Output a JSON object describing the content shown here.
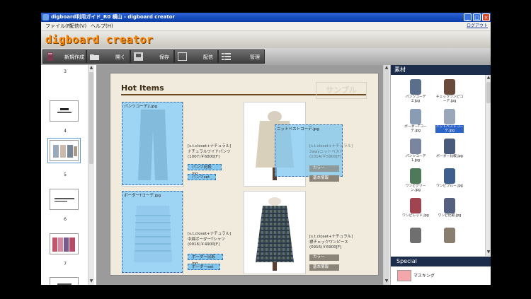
{
  "window": {
    "title": "digboard利用ガイド_R0 横山 - digboard creator",
    "controls": [
      "_",
      "□",
      "×"
    ]
  },
  "menu": {
    "items": [
      "ファイル(F)",
      "配信(V)",
      "ヘルプ(H)"
    ],
    "logout": "ログアウト"
  },
  "brand": {
    "logo": "digboard creator"
  },
  "toolbar": {
    "new": "新規作成",
    "open": "開く",
    "save": "保存",
    "publish": "配信",
    "manage": "管理"
  },
  "pages": {
    "numbers": [
      "3",
      "4",
      "5",
      "6",
      "7"
    ]
  },
  "canvas": {
    "heading": "Hot Items",
    "watermark": "サンプル",
    "products": [
      {
        "overlay_label": "パンツコーデ2.jpg",
        "text": [
          "[s.t.closet+ナチュラル]",
          "ナチュラルワイドパンツ",
          "(1007)￥6800[F]"
        ],
        "tags": [
          "パンツ比較jpg",
          "パンツset"
        ]
      },
      {
        "overlay_label": "ニットベストコーデ.jpg",
        "text": [
          "[s.t.closet+ナチュラル]",
          "2wayニットベスト",
          "(1014)￥5900[F]"
        ],
        "tags": [
          "カラー",
          "基本情報"
        ]
      },
      {
        "overlay_label": "ボーダーTコーデ.jpg",
        "text": [
          "[s.t.closet+ナチュラル]",
          "中綿ボーダーTシャツ",
          "(0916)￥4900[F]"
        ],
        "tags": [
          "ボーダー比較jpg",
          "ボーダーset"
        ]
      },
      {
        "overlay_label": "",
        "text": [
          "[s.t.closet+ナチュラル]",
          "襟チェックワンピース",
          "(0916)￥6900[F]"
        ],
        "tags": [
          "カラー",
          "基本情報"
        ]
      }
    ]
  },
  "materials": {
    "header": "素材",
    "items": [
      {
        "name": "パンツコーデ2.jpg",
        "color": "#5b6f8c"
      },
      {
        "name": "チェックワンピコーデ.jpg",
        "color": "#6a4a3a"
      },
      {
        "name": "ボーダーTコーデ.jpg",
        "color": "#8a9bb4"
      },
      {
        "name": "ニットベストコーデ.jpg",
        "color": "#9aa7b8",
        "selected": true
      },
      {
        "name": "パンツコーデ1.jpg",
        "color": "#7a86a0"
      },
      {
        "name": "ボーダー比較.jpg",
        "color": "#4a5a7a"
      },
      {
        "name": "ワンピグリーン.jpg",
        "color": "#4f7a5a"
      },
      {
        "name": "ワンピブルー.jpg",
        "color": "#3f5f8f"
      },
      {
        "name": "ワンピレッド.jpg",
        "color": "#a04550"
      },
      {
        "name": "ワンピ比較.jpg",
        "color": "#556080"
      },
      {
        "name": "",
        "color": "#6f6f6f"
      },
      {
        "name": "",
        "color": "#8a7f6f"
      }
    ],
    "special_header": "Special",
    "special_items": [
      {
        "name": "マスキング",
        "color": "#f4a7ab"
      }
    ]
  }
}
